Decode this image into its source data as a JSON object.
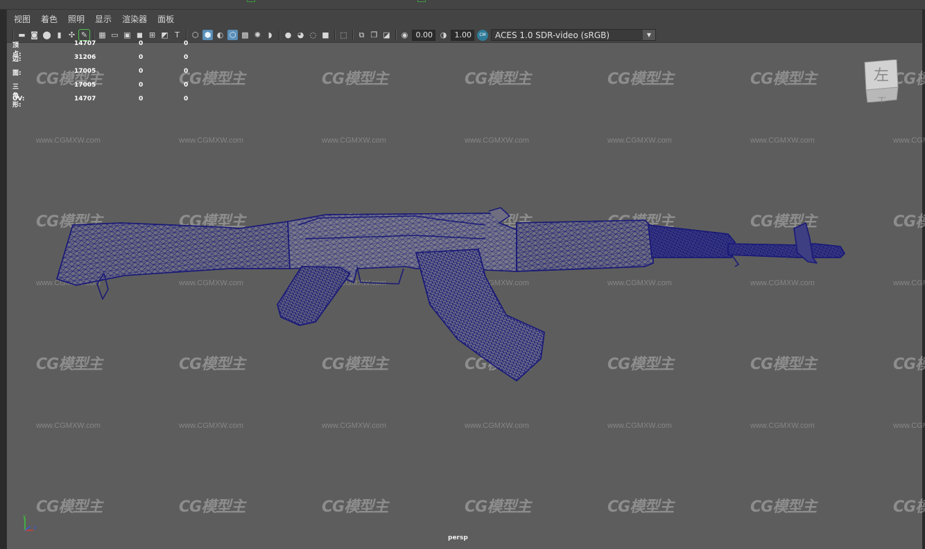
{
  "menu": [
    "视图",
    "着色",
    "照明",
    "显示",
    "渲染器",
    "面板"
  ],
  "toolbar": {
    "icons": [
      "camera-icon",
      "camera-attributes-icon",
      "bookmark-icon",
      "image-plane-icon",
      "grease-pencil-icon",
      "grid-icon",
      "film-gate-icon",
      "resolution-gate-icon",
      "gate-mask-icon",
      "field-chart-icon",
      "safe-action-icon",
      "safe-title-icon",
      "wireframe-icon",
      "smooth-shade-icon",
      "default-material-icon",
      "wireframe-on-shaded-icon",
      "xray-icon",
      "use-lights-icon",
      "shadows-icon",
      "ambient-occlusion-icon",
      "motion-blur-icon",
      "anti-alias-icon",
      "depth-of-field-icon",
      "isolate-select-icon",
      "xray-joints-icon",
      "backface-culling-icon",
      "exposure-icon",
      "gamma-icon"
    ],
    "exposure_value": "0.00",
    "gamma_value": "1.00",
    "colorspace_label": "ACES 1.0 SDR-video (sRGB)"
  },
  "hud": [
    {
      "label": "顶点:",
      "v1": "14707",
      "v2": "0",
      "v3": "0"
    },
    {
      "label": "边:",
      "v1": "31206",
      "v2": "0",
      "v3": "0"
    },
    {
      "label": "面:",
      "v1": "17005",
      "v2": "0",
      "v3": "0"
    },
    {
      "label": "三角形:",
      "v1": "17005",
      "v2": "0",
      "v3": "0"
    },
    {
      "label": "UV:",
      "v1": "14707",
      "v2": "0",
      "v3": "0"
    }
  ],
  "viewcube_face": "左",
  "camera_label": "persp",
  "watermark_logo": "CG模型主",
  "watermark_url": "www.CGMXW.com",
  "colors": {
    "viewport_bg": "#5d5d5d",
    "wireframe": "#1a1a78",
    "model_fill": "#6e6e80",
    "accent": "#5a8fb8"
  }
}
